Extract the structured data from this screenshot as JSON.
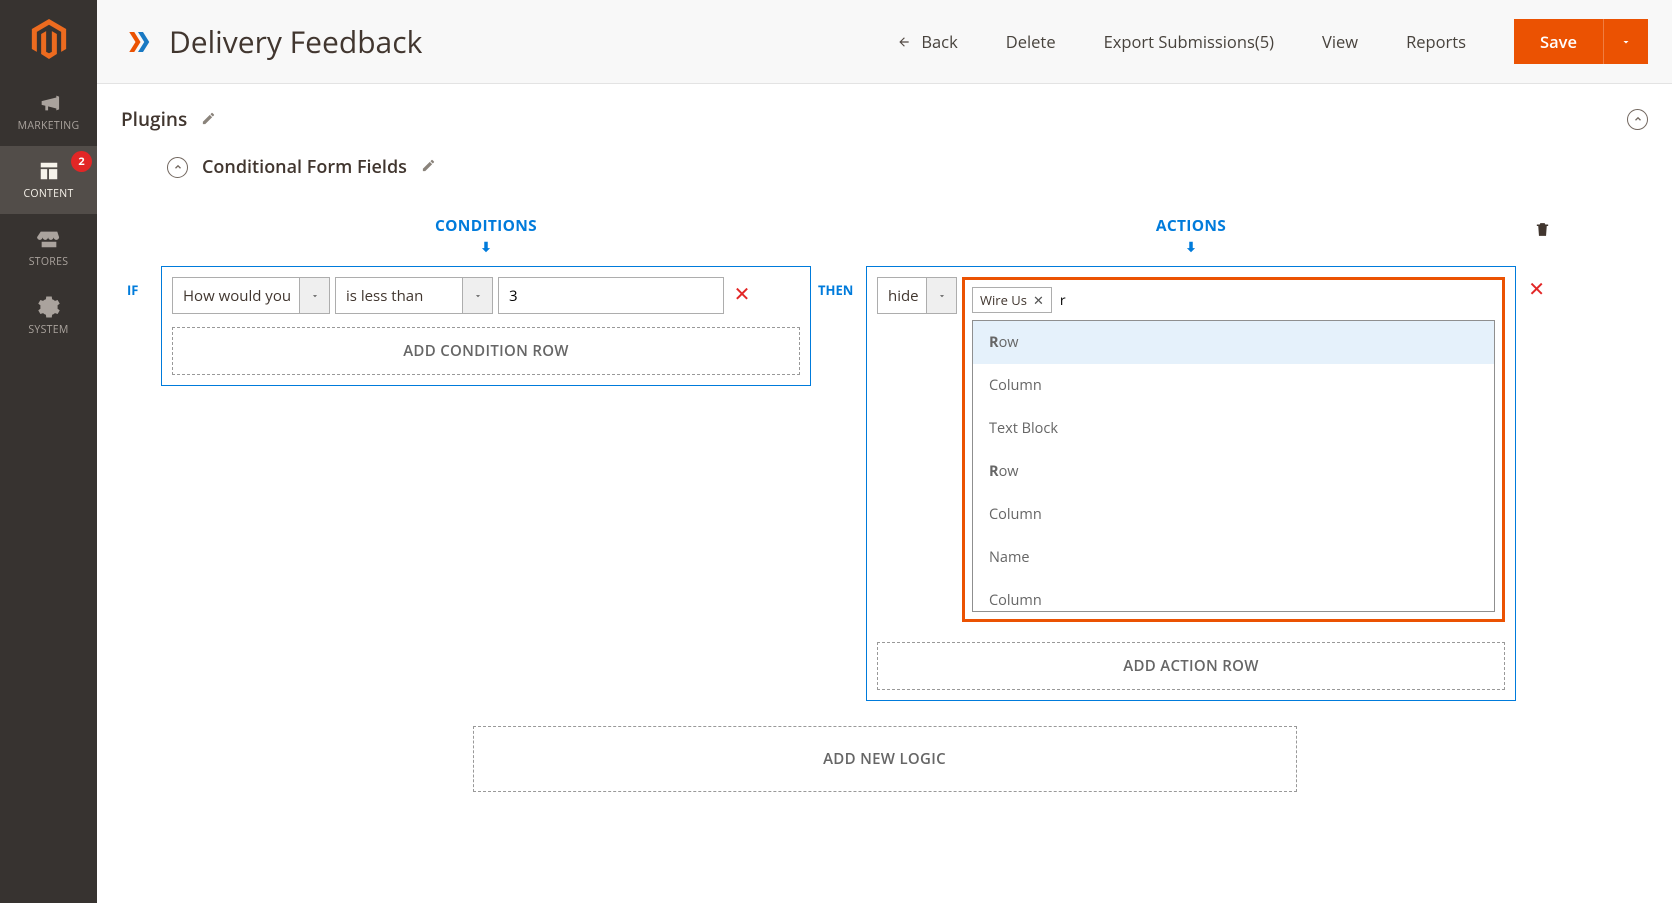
{
  "sidebar": {
    "items": [
      {
        "id": "marketing",
        "label": "MARKETING"
      },
      {
        "id": "content",
        "label": "CONTENT",
        "active": true,
        "badge": "2"
      },
      {
        "id": "stores",
        "label": "STORES"
      },
      {
        "id": "system",
        "label": "SYSTEM"
      }
    ]
  },
  "header": {
    "title": "Delivery Feedback",
    "back": "Back",
    "delete": "Delete",
    "export": "Export Submissions(5)",
    "view": "View",
    "reports": "Reports",
    "save": "Save"
  },
  "panel": {
    "plugins": "Plugins",
    "subsection": "Conditional Form Fields"
  },
  "columns": {
    "conditions": "CONDITIONS",
    "actions": "ACTIONS",
    "if": "IF",
    "then": "THEN"
  },
  "condition": {
    "field": "How would you",
    "operator": "is less than",
    "value": "3",
    "add_row": "ADD CONDITION ROW"
  },
  "action": {
    "verb": "hide",
    "chip": "Wire Us",
    "search": "r",
    "options": [
      {
        "bold": "R",
        "rest": "ow"
      },
      {
        "bold": "",
        "rest": "Column"
      },
      {
        "bold": "",
        "rest": "Text Block"
      },
      {
        "bold": "R",
        "rest": "ow"
      },
      {
        "bold": "",
        "rest": "Column"
      },
      {
        "bold": "",
        "rest": "Name"
      },
      {
        "bold": "",
        "rest": "Column"
      }
    ],
    "add_row": "ADD ACTION ROW"
  },
  "add_logic": "ADD NEW LOGIC"
}
